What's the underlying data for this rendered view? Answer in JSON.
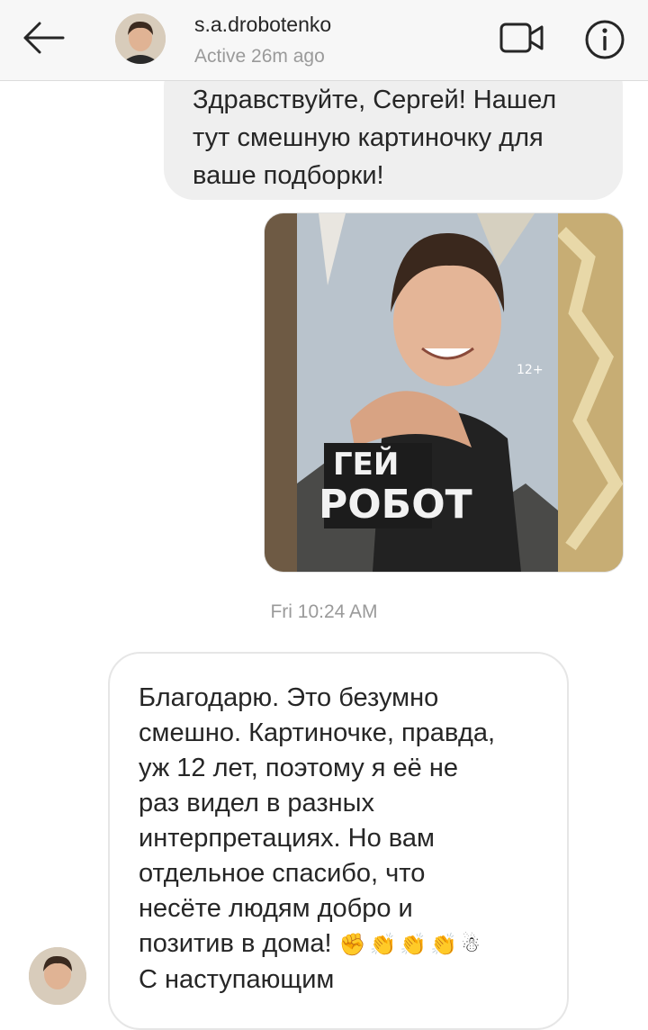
{
  "header": {
    "username": "s.a.drobotenko",
    "status": "Active 26m ago",
    "icons": {
      "back": "arrow-left-icon",
      "video": "video-camera-icon",
      "info": "info-icon"
    }
  },
  "messages": [
    {
      "direction": "outgoing",
      "type": "text",
      "text": "Здравствуйте, Сергей! Нашел тут смешную картиночку для ваше подборки!"
    },
    {
      "direction": "outgoing",
      "type": "image",
      "image_text": {
        "top": "ГЕЙ",
        "bottom": "РОБОТ",
        "age": "12+"
      }
    }
  ],
  "timestamp": "Fri 10:24 AM",
  "reply": {
    "direction": "incoming",
    "lines": [
      "Благодарю. Это безумно",
      "смешно. Картиночке, правда,",
      "уж 12 лет, поэтому я её не",
      "раз видел в разных",
      "интерпретациях. Но вам",
      "отдельное спасибо, что",
      "несёте людям добро и",
      "позитив в дома!"
    ],
    "emoji": "✊👏👏👏☃",
    "last_line": "С наступающим"
  },
  "colors": {
    "header_bg": "#f7f7f7",
    "outgoing_bubble": "#efefef",
    "text": "#262626",
    "muted": "#9a9a9a"
  }
}
